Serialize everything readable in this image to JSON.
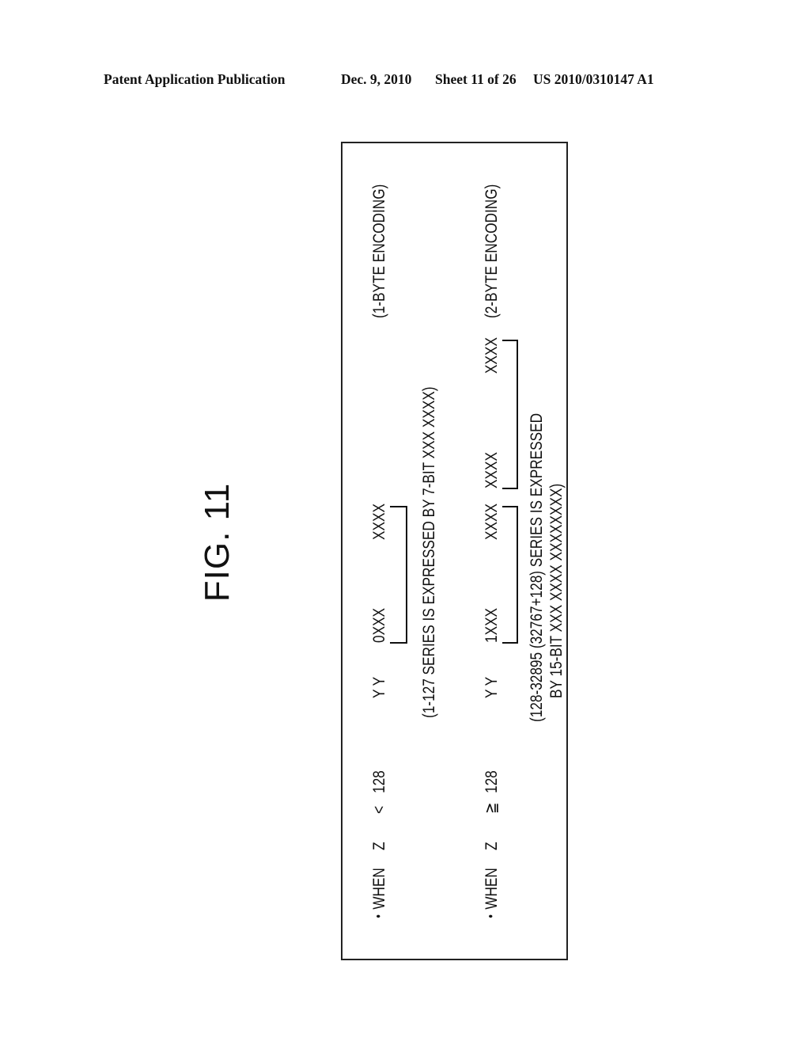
{
  "header": {
    "publication": "Patent Application Publication",
    "date": "Dec. 9, 2010",
    "sheet": "Sheet 11 of 26",
    "number": "US 2010/0310147 A1"
  },
  "figure": {
    "title": "FIG. 11",
    "case1": {
      "bullet": "・WHEN",
      "variable": "Z",
      "operator": "<",
      "threshold": "128",
      "prefix": "Y Y",
      "byte1": "0XXX",
      "byte1b": "XXXX",
      "encoding": "(1-BYTE ENCODING)",
      "note": "(1-127 SERIES IS EXPRESSED BY 7-BIT XXX XXXX)"
    },
    "case2": {
      "bullet": "・WHEN",
      "variable": "Z",
      "operator": "≧",
      "threshold": "128",
      "prefix": "Y Y",
      "byte1": "1XXX",
      "byte1b": "XXXX",
      "byte2": "XXXX",
      "byte2b": "XXXX",
      "encoding": "(2-BYTE ENCODING)",
      "note_line1": "(128-32895 (32767+128) SERIES IS EXPRESSED",
      "note_line2": "BY 15-BIT XXX XXXX  XXXXXXXX)"
    }
  }
}
